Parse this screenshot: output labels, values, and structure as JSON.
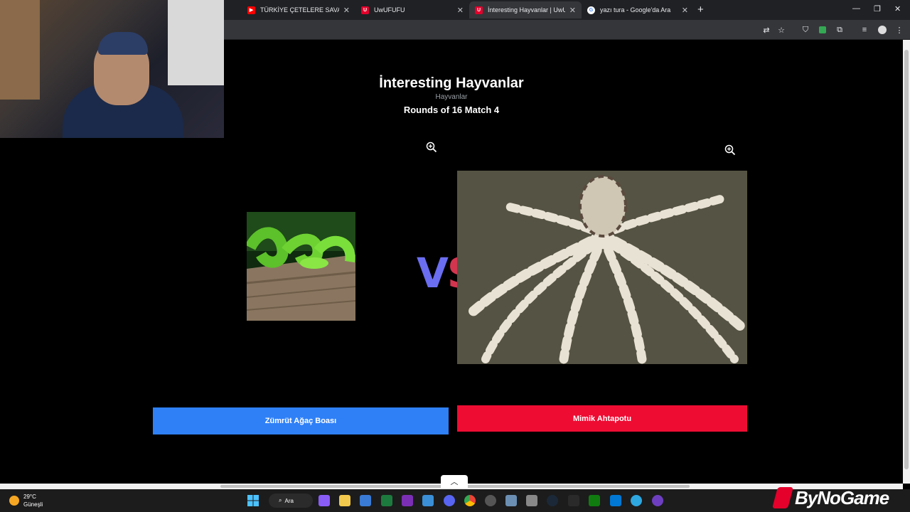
{
  "browser": {
    "tabs": [
      {
        "title": "TÜRKİYE ÇETELERE SAVAŞ AÇTI",
        "favicon": "youtube-icon",
        "color": "#ff0000",
        "active": false
      },
      {
        "title": "UwUFUFU",
        "favicon": "uwufufu-icon",
        "color": "#e4002b",
        "active": false
      },
      {
        "title": "İnteresting Hayvanlar | UwUFUFU",
        "favicon": "uwufufu-icon",
        "color": "#e4002b",
        "active": true
      },
      {
        "title": "yazı tura - Google'da Ara",
        "favicon": "google-icon",
        "color": "#4285f4",
        "active": false
      }
    ],
    "new_tab": "+"
  },
  "page": {
    "title": "İnteresting Hayvanlar",
    "category": "Hayvanlar",
    "round_text": "Rounds of 16 Match 4",
    "vs_left": "V",
    "vs_right": "S",
    "left_choice": {
      "label": "Zümrüt Ağaç Boası",
      "color": "#2f80f7"
    },
    "right_choice": {
      "label": "Mimik Ahtapotu",
      "color": "#ee0c33"
    }
  },
  "taskbar": {
    "weather_temp": "29°C",
    "weather_desc": "Güneşli",
    "search_label": "Ara"
  },
  "overlay": {
    "brand": "ByNoGame"
  }
}
